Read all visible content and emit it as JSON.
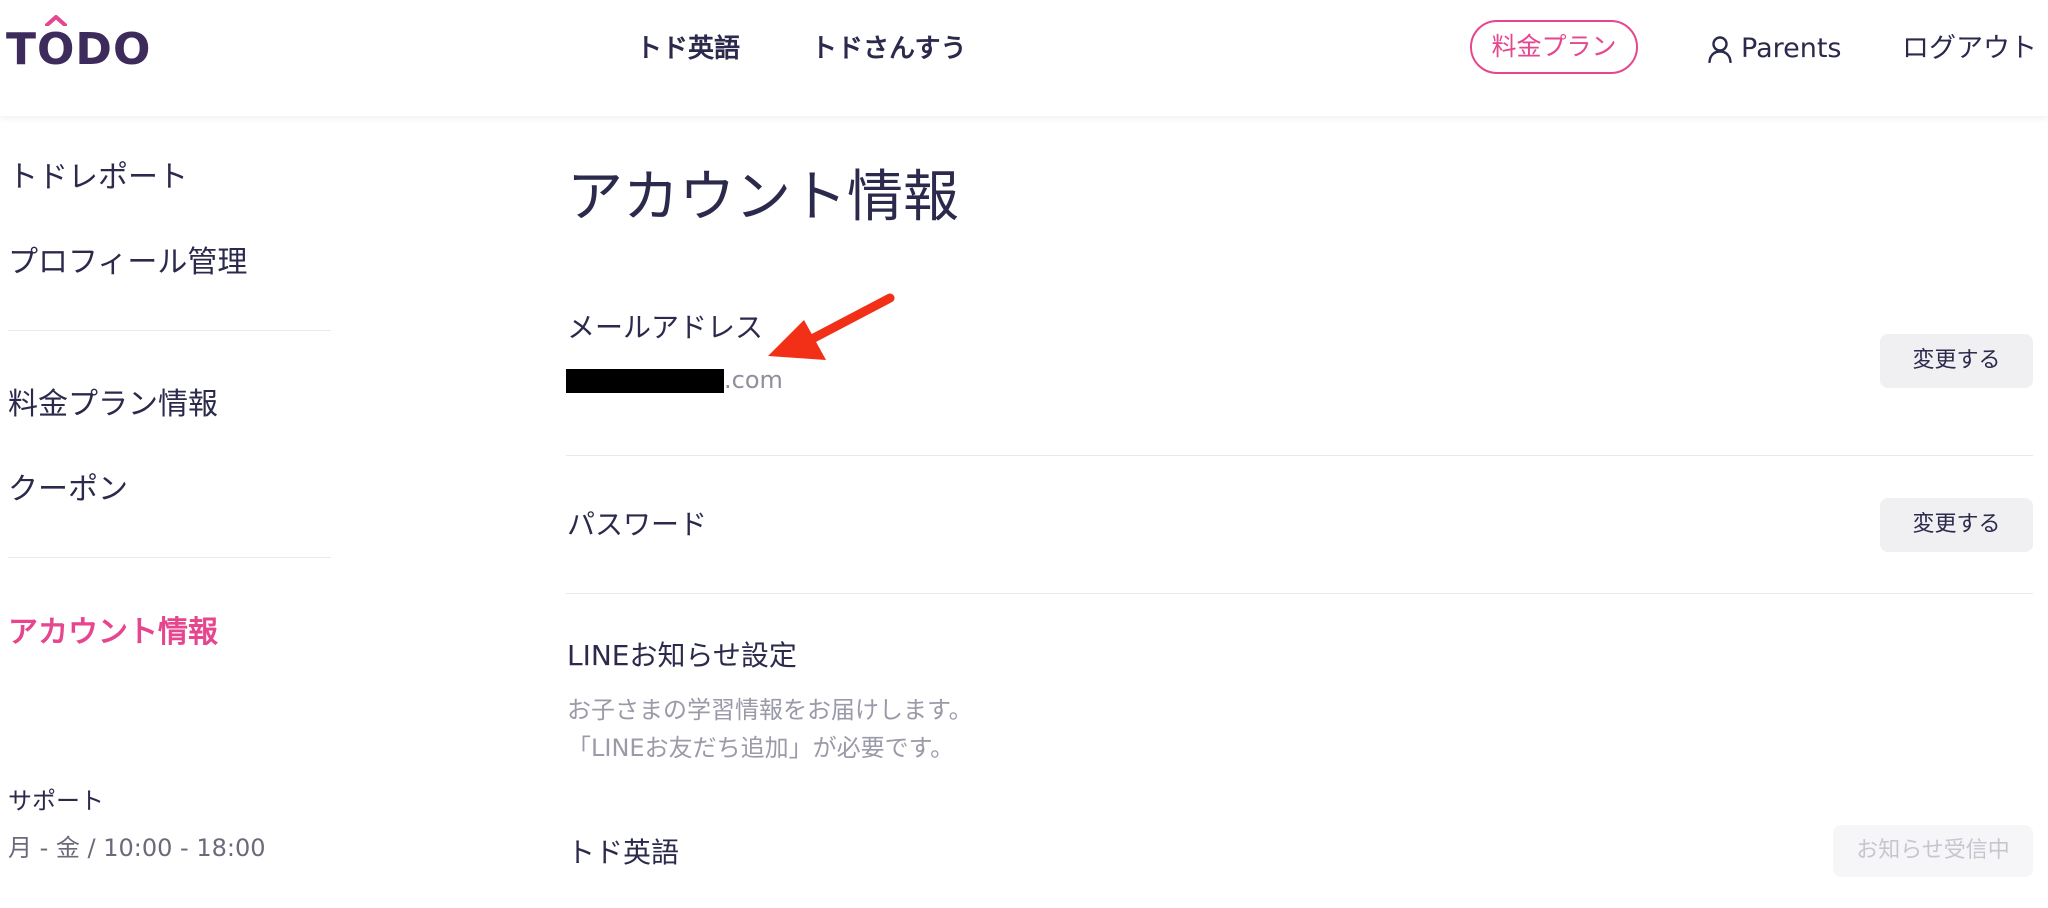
{
  "header": {
    "logo_text_t": "T",
    "logo_text_o": "O",
    "logo_text_rest": "DO",
    "nav": [
      {
        "label": "トド英語"
      },
      {
        "label": "トドさんすう"
      }
    ],
    "plan_button": "料金プラン",
    "parents_label": "Parents",
    "logout_label": "ログアウト"
  },
  "sidebar": {
    "items": [
      {
        "label": "トドレポート"
      },
      {
        "label": "プロフィール管理"
      },
      {
        "label": "料金プラン情報"
      },
      {
        "label": "クーポン"
      },
      {
        "label": "アカウント情報",
        "active": true
      }
    ],
    "support_label": "サポート",
    "support_hours": "月 - 金 / 10:00 - 18:00"
  },
  "main": {
    "title": "アカウント情報",
    "email": {
      "label": "メールアドレス",
      "value_suffix": ".com",
      "change_button": "変更する"
    },
    "password": {
      "label": "パスワード",
      "change_button": "変更する"
    },
    "line": {
      "label": "LINEお知らせ設定",
      "desc_line1": "お子さまの学習情報をお届けします。",
      "desc_line2": "「LINEお友だち追加」が必要です。"
    },
    "todo_eigo": {
      "label": "トド英語",
      "status_button": "お知らせ受信中"
    }
  },
  "colors": {
    "accent_pink": "#e6468d",
    "text_dark": "#2b2a4c",
    "annotation_arrow": "#f22f17"
  }
}
